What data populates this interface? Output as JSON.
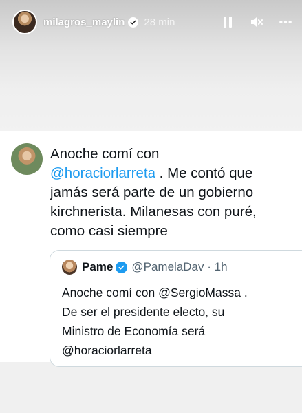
{
  "story": {
    "username": "milagros_maylin",
    "time": "28 min",
    "icons": [
      "pause-icon",
      "muted-speaker-icon",
      "more-icon"
    ]
  },
  "tweet": {
    "line1": "Anoche comí con",
    "mention": "@horaciorlarreta",
    "line2_rest": " . Me contó que",
    "line3": "jamás será parte de un gobierno",
    "line4": "kirchnerista. Milanesas con puré,",
    "line5": "como casi siempre",
    "quote": {
      "name": "Pame",
      "handle": "@PamelaDav · 1h",
      "line1": "Anoche comí con @SergioMassa .",
      "line2": "De ser el presidente electo, su",
      "line3": "Ministro de Economía será",
      "line4": "@horaciorlarreta"
    }
  },
  "colors": {
    "link": "#1d9bf0",
    "text": "#0f1419",
    "secondary": "#536471"
  }
}
